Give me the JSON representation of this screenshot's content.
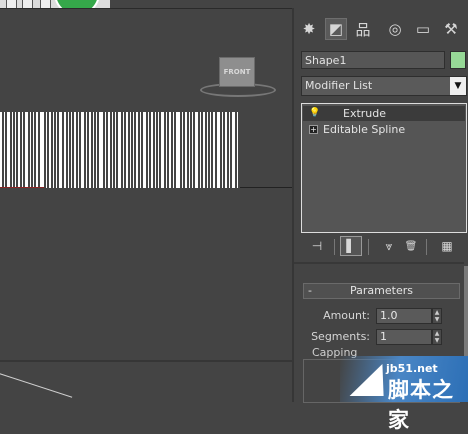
{
  "viewport": {
    "viewcube_label": "FRONT",
    "barcode_bars": [
      [
        0,
        2
      ],
      [
        4,
        1
      ],
      [
        7,
        3
      ],
      [
        12,
        1
      ],
      [
        15,
        1
      ],
      [
        18,
        2
      ],
      [
        22,
        1
      ],
      [
        25,
        3
      ],
      [
        30,
        1
      ],
      [
        33,
        1
      ],
      [
        36,
        2
      ],
      [
        40,
        4
      ],
      [
        46,
        1
      ],
      [
        49,
        2
      ],
      [
        53,
        1
      ],
      [
        56,
        1
      ],
      [
        59,
        3
      ],
      [
        64,
        2
      ],
      [
        68,
        1
      ],
      [
        71,
        1
      ],
      [
        74,
        2
      ],
      [
        78,
        1
      ],
      [
        81,
        3
      ],
      [
        86,
        1
      ],
      [
        89,
        2
      ],
      [
        93,
        1
      ],
      [
        96,
        1
      ],
      [
        99,
        4
      ],
      [
        105,
        1
      ],
      [
        108,
        2
      ],
      [
        112,
        1
      ],
      [
        115,
        1
      ],
      [
        118,
        3
      ],
      [
        123,
        1
      ],
      [
        126,
        2
      ],
      [
        130,
        1
      ],
      [
        133,
        1
      ],
      [
        136,
        2
      ],
      [
        140,
        1
      ],
      [
        143,
        3
      ],
      [
        148,
        1
      ],
      [
        151,
        2
      ],
      [
        155,
        1
      ],
      [
        158,
        1
      ],
      [
        161,
        3
      ],
      [
        166,
        1
      ],
      [
        169,
        2
      ],
      [
        173,
        1
      ],
      [
        176,
        4
      ],
      [
        182,
        1
      ],
      [
        185,
        2
      ],
      [
        189,
        1
      ],
      [
        192,
        1
      ],
      [
        195,
        3
      ],
      [
        200,
        1
      ],
      [
        203,
        2
      ],
      [
        207,
        1
      ],
      [
        210,
        1
      ],
      [
        213,
        2
      ],
      [
        217,
        3
      ],
      [
        222,
        1
      ],
      [
        225,
        2
      ],
      [
        229,
        1
      ],
      [
        232,
        3
      ],
      [
        237,
        1
      ]
    ]
  },
  "command_panel": {
    "tabs": [
      {
        "name": "create-tab",
        "glyph": "✸"
      },
      {
        "name": "modify-tab",
        "glyph": "◩"
      },
      {
        "name": "hierarchy-tab",
        "glyph": "品"
      },
      {
        "name": "motion-tab",
        "glyph": "◎"
      },
      {
        "name": "display-tab",
        "glyph": "▭"
      },
      {
        "name": "utilities-tab",
        "glyph": "⚒"
      }
    ],
    "object_name": "Shape1",
    "object_color": "#96d896",
    "modifier_list_label": "Modifier List",
    "stack": {
      "items": [
        {
          "label": "Extrude",
          "selected": true
        },
        {
          "label": "Editable Spline",
          "selected": false
        }
      ]
    },
    "stack_tools": [
      {
        "name": "pin-stack-icon",
        "glyph": "⊣"
      },
      {
        "name": "show-end-result-icon",
        "glyph": "▌"
      },
      {
        "name": "make-unique-icon",
        "glyph": "⩔"
      },
      {
        "name": "remove-modifier-icon",
        "glyph": "🗑"
      },
      {
        "name": "configure-modifier-sets-icon",
        "glyph": "▦"
      }
    ],
    "parameters": {
      "rollout_title": "Parameters",
      "rollout_toggle": "-",
      "amount_label": "Amount:",
      "amount_value": "1.0",
      "segments_label": "Segments:",
      "segments_value": "1",
      "capping_label": "Capping"
    }
  },
  "watermark": {
    "site": "jb51.net",
    "brand": "脚本之家"
  }
}
